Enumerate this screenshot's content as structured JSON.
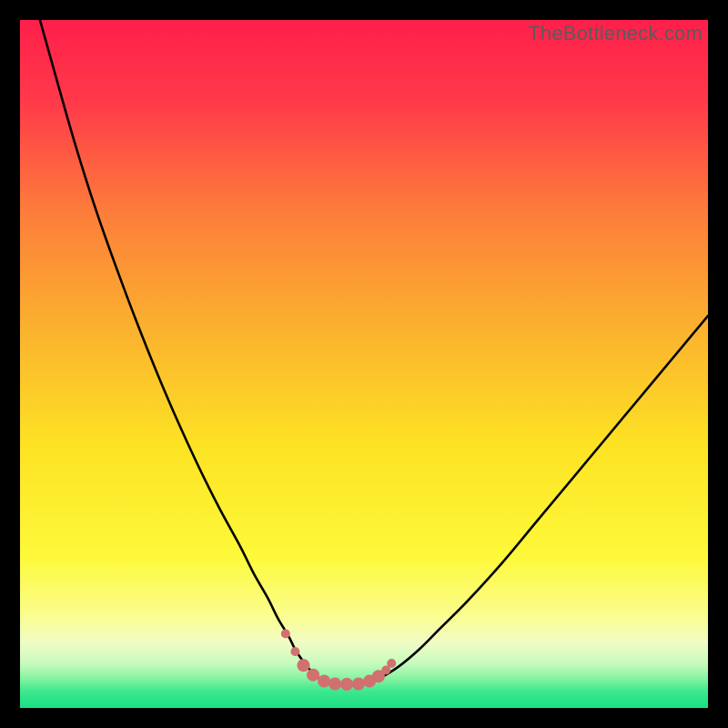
{
  "watermark": "TheBottleneck.com",
  "chart_data": {
    "type": "line",
    "title": "",
    "xlabel": "",
    "ylabel": "",
    "xlim": [
      0,
      100
    ],
    "ylim": [
      0,
      100
    ],
    "background_gradient": {
      "stops": [
        {
          "pos": 0.0,
          "color": "#ff1f4b"
        },
        {
          "pos": 0.12,
          "color": "#ff3a49"
        },
        {
          "pos": 0.28,
          "color": "#fd7d3b"
        },
        {
          "pos": 0.45,
          "color": "#fbb22e"
        },
        {
          "pos": 0.62,
          "color": "#fde324"
        },
        {
          "pos": 0.78,
          "color": "#fdf93a"
        },
        {
          "pos": 0.865,
          "color": "#fbfd8e"
        },
        {
          "pos": 0.905,
          "color": "#f0fcc5"
        },
        {
          "pos": 0.935,
          "color": "#c8fbbd"
        },
        {
          "pos": 0.955,
          "color": "#8ef4a5"
        },
        {
          "pos": 0.975,
          "color": "#3fe88d"
        },
        {
          "pos": 1.0,
          "color": "#1adf85"
        }
      ]
    },
    "series": [
      {
        "name": "bottleneck-curve",
        "color": "#000000",
        "x": [
          2.9,
          5,
          8,
          11,
          14,
          17,
          20,
          23,
          26,
          29,
          32,
          34,
          36,
          37.5,
          39,
          40,
          41,
          42,
          43,
          44,
          45,
          46.5,
          48,
          50,
          52,
          55,
          58,
          61,
          65,
          70,
          75,
          80,
          85,
          90,
          95,
          100
        ],
        "y": [
          100,
          92.5,
          82,
          72.5,
          64,
          56,
          48.5,
          41.5,
          35,
          29,
          23.5,
          19.5,
          16,
          13,
          10.5,
          8.5,
          7,
          5.7,
          4.7,
          4,
          3.6,
          3.45,
          3.45,
          3.55,
          4.2,
          6,
          8.5,
          11.5,
          15.5,
          21,
          27,
          33,
          39,
          45,
          51,
          57
        ]
      }
    ],
    "markers": {
      "name": "valley-markers",
      "color": "#d1716f",
      "radius_main": 7,
      "radius_small": 5,
      "points": [
        {
          "x": 38.6,
          "y": 10.8,
          "r": "small"
        },
        {
          "x": 40.0,
          "y": 8.2,
          "r": "small"
        },
        {
          "x": 41.2,
          "y": 6.2,
          "r": "main"
        },
        {
          "x": 42.6,
          "y": 4.8,
          "r": "main"
        },
        {
          "x": 44.2,
          "y": 3.9,
          "r": "main"
        },
        {
          "x": 45.8,
          "y": 3.5,
          "r": "main"
        },
        {
          "x": 47.5,
          "y": 3.45,
          "r": "main"
        },
        {
          "x": 49.2,
          "y": 3.5,
          "r": "main"
        },
        {
          "x": 50.8,
          "y": 3.9,
          "r": "main"
        },
        {
          "x": 52.1,
          "y": 4.6,
          "r": "main"
        },
        {
          "x": 53.2,
          "y": 5.5,
          "r": "small"
        },
        {
          "x": 54.0,
          "y": 6.5,
          "r": "small"
        }
      ]
    }
  }
}
